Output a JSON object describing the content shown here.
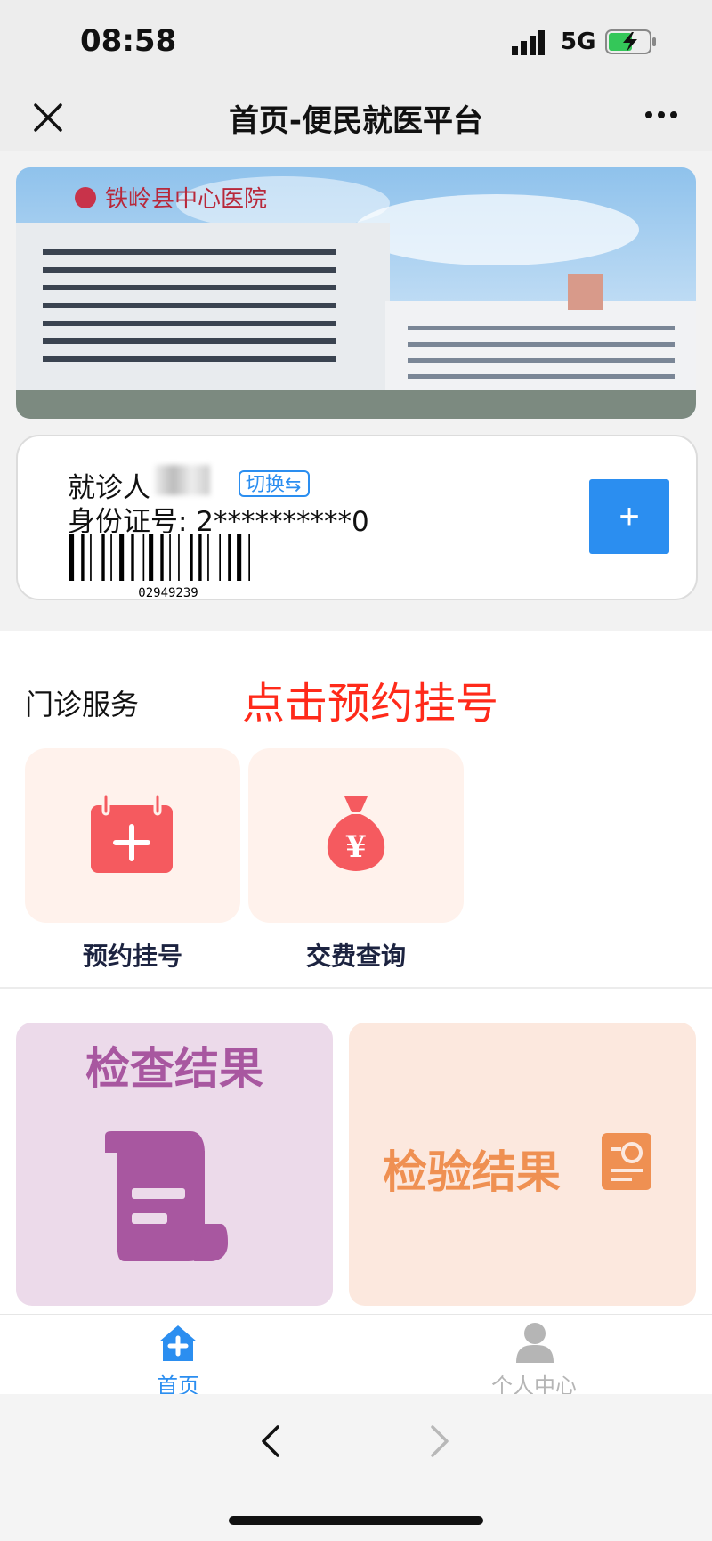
{
  "status": {
    "time": "08:58",
    "network": "5G"
  },
  "nav": {
    "title": "首页-便民就医平台"
  },
  "patient": {
    "label": "就诊人",
    "switch_label": "切换⇆",
    "id_text": "身份证号: 2**********0",
    "barcode_number": "02949239",
    "add_label": "+"
  },
  "banner": {
    "hospital_sign": "铁岭县中心医院"
  },
  "services": {
    "section_title": "门诊服务",
    "hint": "点击预约挂号",
    "tiles": [
      {
        "label": "预约挂号",
        "icon": "calendar-plus-icon"
      },
      {
        "label": "交费查询",
        "icon": "money-bag-icon"
      }
    ]
  },
  "results": {
    "exam_title": "检查结果",
    "lab_title": "检验结果"
  },
  "tabbar": {
    "home_label": "首页",
    "me_label": "个人中心"
  },
  "colors": {
    "primary": "#2b8ef0",
    "hint": "#ff2a1a",
    "tile_bg": "#fff2ec",
    "icon_red": "#f55a5f",
    "exam_purple": "#a857a0",
    "lab_orange": "#ef9052"
  }
}
